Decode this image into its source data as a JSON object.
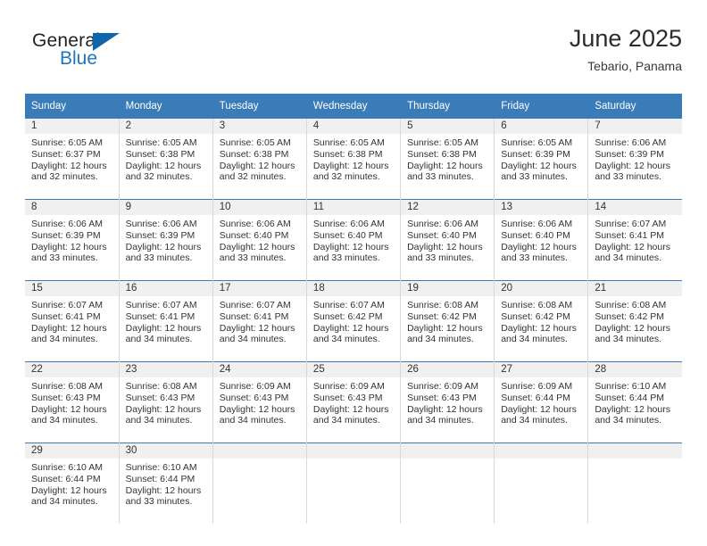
{
  "logo": {
    "word_top": "General",
    "word_bottom": "Blue",
    "triangle_icon": "blue-triangle-icon",
    "accent_color": "#1066ab"
  },
  "header": {
    "title": "June 2025",
    "subtitle": "Tebario, Panama"
  },
  "theme": {
    "header_blue": "#3a7cb8",
    "band_gray": "#f0f0f0",
    "text": "#333333"
  },
  "calendar": {
    "weekday_headers": [
      "Sunday",
      "Monday",
      "Tuesday",
      "Wednesday",
      "Thursday",
      "Friday",
      "Saturday"
    ],
    "labels": {
      "sunrise_prefix": "Sunrise:",
      "sunset_prefix": "Sunset:",
      "daylight_prefix": "Daylight:"
    },
    "weeks": [
      [
        {
          "day": "1",
          "sunrise": "Sunrise: 6:05 AM",
          "sunset": "Sunset: 6:37 PM",
          "daylight_1": "Daylight: 12 hours",
          "daylight_2": "and 32 minutes."
        },
        {
          "day": "2",
          "sunrise": "Sunrise: 6:05 AM",
          "sunset": "Sunset: 6:38 PM",
          "daylight_1": "Daylight: 12 hours",
          "daylight_2": "and 32 minutes."
        },
        {
          "day": "3",
          "sunrise": "Sunrise: 6:05 AM",
          "sunset": "Sunset: 6:38 PM",
          "daylight_1": "Daylight: 12 hours",
          "daylight_2": "and 32 minutes."
        },
        {
          "day": "4",
          "sunrise": "Sunrise: 6:05 AM",
          "sunset": "Sunset: 6:38 PM",
          "daylight_1": "Daylight: 12 hours",
          "daylight_2": "and 32 minutes."
        },
        {
          "day": "5",
          "sunrise": "Sunrise: 6:05 AM",
          "sunset": "Sunset: 6:38 PM",
          "daylight_1": "Daylight: 12 hours",
          "daylight_2": "and 33 minutes."
        },
        {
          "day": "6",
          "sunrise": "Sunrise: 6:05 AM",
          "sunset": "Sunset: 6:39 PM",
          "daylight_1": "Daylight: 12 hours",
          "daylight_2": "and 33 minutes."
        },
        {
          "day": "7",
          "sunrise": "Sunrise: 6:06 AM",
          "sunset": "Sunset: 6:39 PM",
          "daylight_1": "Daylight: 12 hours",
          "daylight_2": "and 33 minutes."
        }
      ],
      [
        {
          "day": "8",
          "sunrise": "Sunrise: 6:06 AM",
          "sunset": "Sunset: 6:39 PM",
          "daylight_1": "Daylight: 12 hours",
          "daylight_2": "and 33 minutes."
        },
        {
          "day": "9",
          "sunrise": "Sunrise: 6:06 AM",
          "sunset": "Sunset: 6:39 PM",
          "daylight_1": "Daylight: 12 hours",
          "daylight_2": "and 33 minutes."
        },
        {
          "day": "10",
          "sunrise": "Sunrise: 6:06 AM",
          "sunset": "Sunset: 6:40 PM",
          "daylight_1": "Daylight: 12 hours",
          "daylight_2": "and 33 minutes."
        },
        {
          "day": "11",
          "sunrise": "Sunrise: 6:06 AM",
          "sunset": "Sunset: 6:40 PM",
          "daylight_1": "Daylight: 12 hours",
          "daylight_2": "and 33 minutes."
        },
        {
          "day": "12",
          "sunrise": "Sunrise: 6:06 AM",
          "sunset": "Sunset: 6:40 PM",
          "daylight_1": "Daylight: 12 hours",
          "daylight_2": "and 33 minutes."
        },
        {
          "day": "13",
          "sunrise": "Sunrise: 6:06 AM",
          "sunset": "Sunset: 6:40 PM",
          "daylight_1": "Daylight: 12 hours",
          "daylight_2": "and 33 minutes."
        },
        {
          "day": "14",
          "sunrise": "Sunrise: 6:07 AM",
          "sunset": "Sunset: 6:41 PM",
          "daylight_1": "Daylight: 12 hours",
          "daylight_2": "and 34 minutes."
        }
      ],
      [
        {
          "day": "15",
          "sunrise": "Sunrise: 6:07 AM",
          "sunset": "Sunset: 6:41 PM",
          "daylight_1": "Daylight: 12 hours",
          "daylight_2": "and 34 minutes."
        },
        {
          "day": "16",
          "sunrise": "Sunrise: 6:07 AM",
          "sunset": "Sunset: 6:41 PM",
          "daylight_1": "Daylight: 12 hours",
          "daylight_2": "and 34 minutes."
        },
        {
          "day": "17",
          "sunrise": "Sunrise: 6:07 AM",
          "sunset": "Sunset: 6:41 PM",
          "daylight_1": "Daylight: 12 hours",
          "daylight_2": "and 34 minutes."
        },
        {
          "day": "18",
          "sunrise": "Sunrise: 6:07 AM",
          "sunset": "Sunset: 6:42 PM",
          "daylight_1": "Daylight: 12 hours",
          "daylight_2": "and 34 minutes."
        },
        {
          "day": "19",
          "sunrise": "Sunrise: 6:08 AM",
          "sunset": "Sunset: 6:42 PM",
          "daylight_1": "Daylight: 12 hours",
          "daylight_2": "and 34 minutes."
        },
        {
          "day": "20",
          "sunrise": "Sunrise: 6:08 AM",
          "sunset": "Sunset: 6:42 PM",
          "daylight_1": "Daylight: 12 hours",
          "daylight_2": "and 34 minutes."
        },
        {
          "day": "21",
          "sunrise": "Sunrise: 6:08 AM",
          "sunset": "Sunset: 6:42 PM",
          "daylight_1": "Daylight: 12 hours",
          "daylight_2": "and 34 minutes."
        }
      ],
      [
        {
          "day": "22",
          "sunrise": "Sunrise: 6:08 AM",
          "sunset": "Sunset: 6:43 PM",
          "daylight_1": "Daylight: 12 hours",
          "daylight_2": "and 34 minutes."
        },
        {
          "day": "23",
          "sunrise": "Sunrise: 6:08 AM",
          "sunset": "Sunset: 6:43 PM",
          "daylight_1": "Daylight: 12 hours",
          "daylight_2": "and 34 minutes."
        },
        {
          "day": "24",
          "sunrise": "Sunrise: 6:09 AM",
          "sunset": "Sunset: 6:43 PM",
          "daylight_1": "Daylight: 12 hours",
          "daylight_2": "and 34 minutes."
        },
        {
          "day": "25",
          "sunrise": "Sunrise: 6:09 AM",
          "sunset": "Sunset: 6:43 PM",
          "daylight_1": "Daylight: 12 hours",
          "daylight_2": "and 34 minutes."
        },
        {
          "day": "26",
          "sunrise": "Sunrise: 6:09 AM",
          "sunset": "Sunset: 6:43 PM",
          "daylight_1": "Daylight: 12 hours",
          "daylight_2": "and 34 minutes."
        },
        {
          "day": "27",
          "sunrise": "Sunrise: 6:09 AM",
          "sunset": "Sunset: 6:44 PM",
          "daylight_1": "Daylight: 12 hours",
          "daylight_2": "and 34 minutes."
        },
        {
          "day": "28",
          "sunrise": "Sunrise: 6:10 AM",
          "sunset": "Sunset: 6:44 PM",
          "daylight_1": "Daylight: 12 hours",
          "daylight_2": "and 34 minutes."
        }
      ],
      [
        {
          "day": "29",
          "sunrise": "Sunrise: 6:10 AM",
          "sunset": "Sunset: 6:44 PM",
          "daylight_1": "Daylight: 12 hours",
          "daylight_2": "and 34 minutes."
        },
        {
          "day": "30",
          "sunrise": "Sunrise: 6:10 AM",
          "sunset": "Sunset: 6:44 PM",
          "daylight_1": "Daylight: 12 hours",
          "daylight_2": "and 33 minutes."
        },
        {
          "day": "",
          "sunrise": "",
          "sunset": "",
          "daylight_1": "",
          "daylight_2": ""
        },
        {
          "day": "",
          "sunrise": "",
          "sunset": "",
          "daylight_1": "",
          "daylight_2": ""
        },
        {
          "day": "",
          "sunrise": "",
          "sunset": "",
          "daylight_1": "",
          "daylight_2": ""
        },
        {
          "day": "",
          "sunrise": "",
          "sunset": "",
          "daylight_1": "",
          "daylight_2": ""
        },
        {
          "day": "",
          "sunrise": "",
          "sunset": "",
          "daylight_1": "",
          "daylight_2": ""
        }
      ]
    ]
  }
}
